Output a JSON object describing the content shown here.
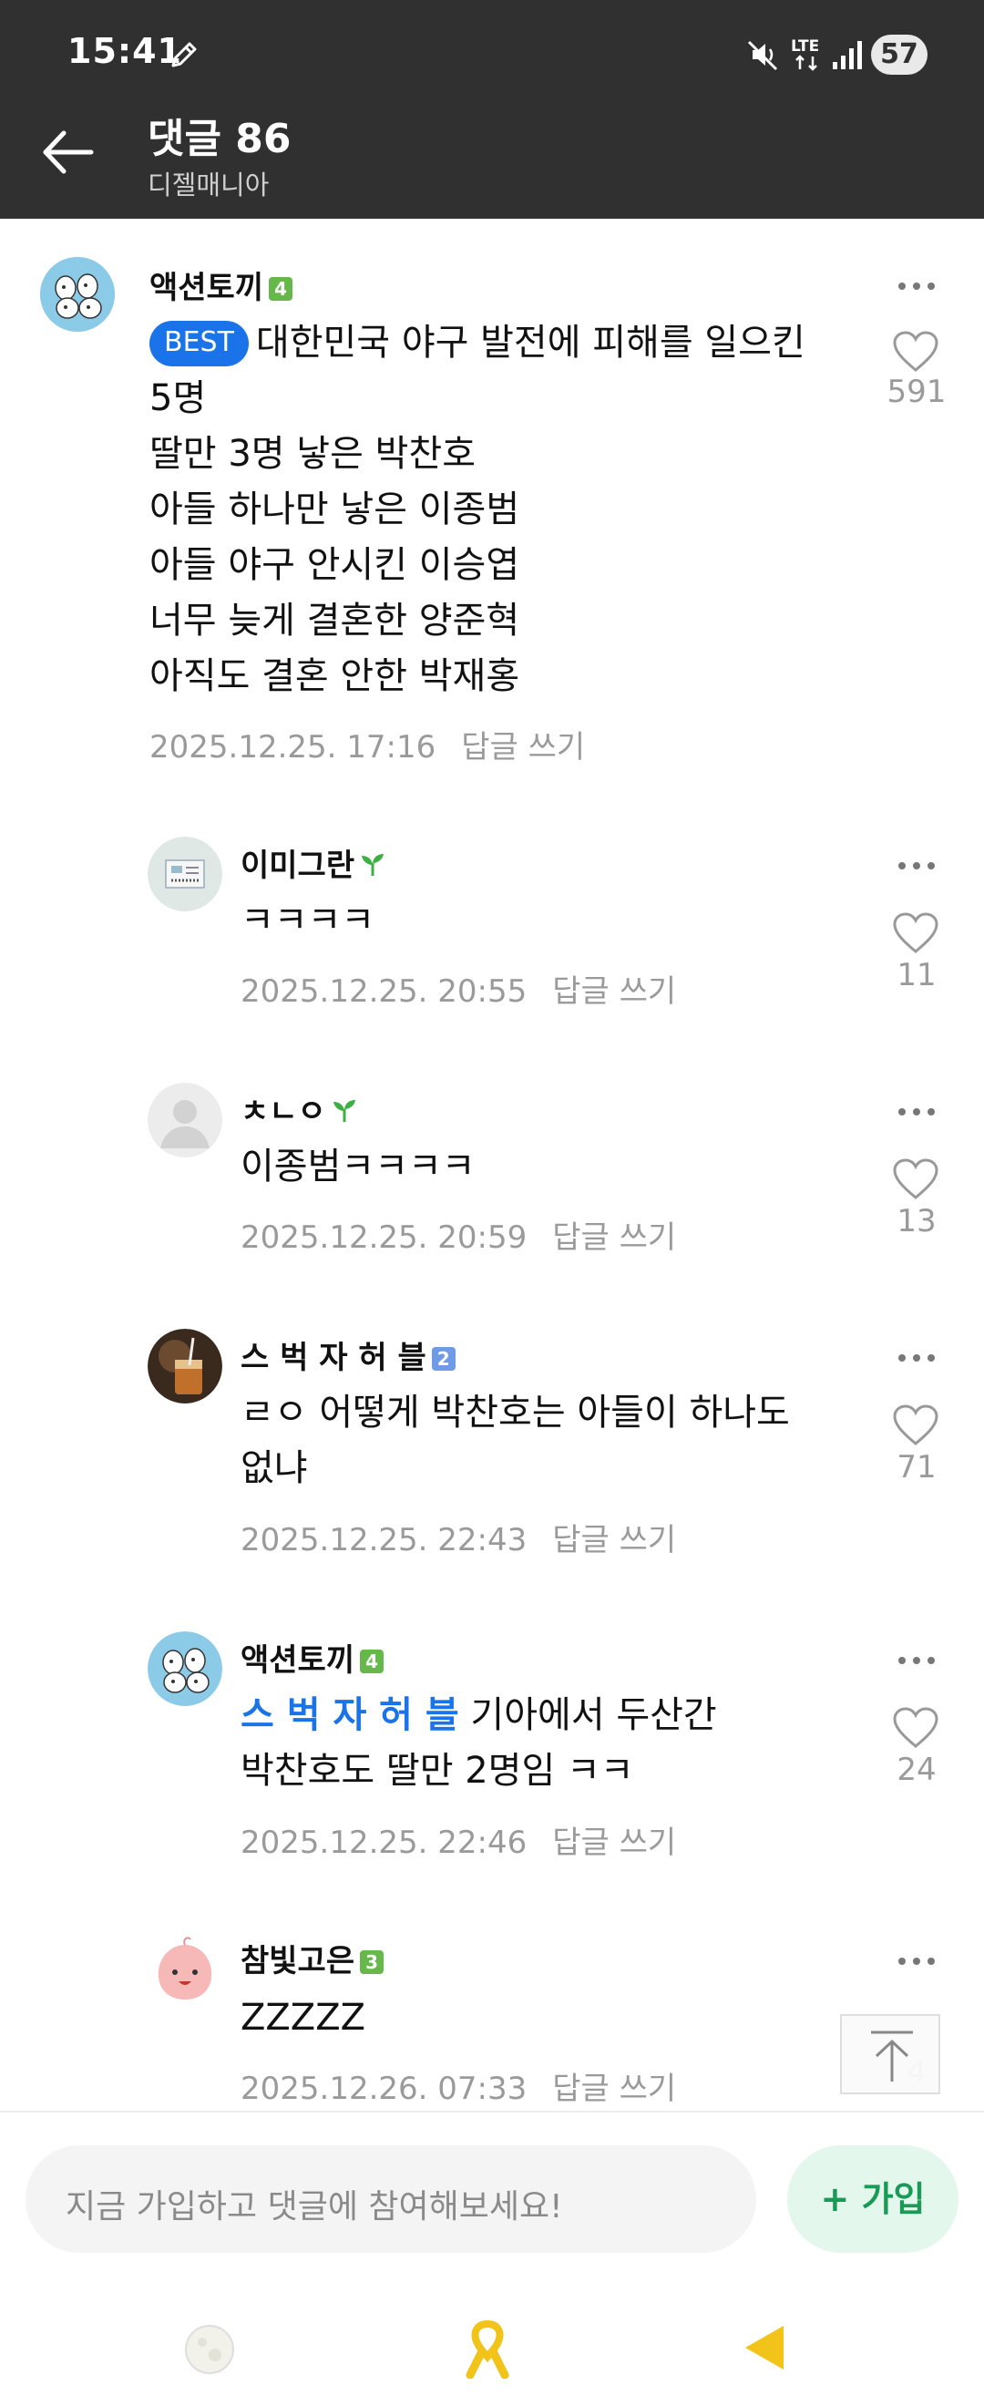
{
  "status_bar": {
    "time": "15:41",
    "network": "LTE",
    "battery": "57",
    "icons": [
      "pen-icon",
      "mute-icon",
      "lte-icon",
      "signal-icon",
      "battery-icon"
    ]
  },
  "header": {
    "title": "댓글 86",
    "subtitle": "디젤매니아"
  },
  "labels": {
    "reply": "답글 쓰기",
    "best": "BEST"
  },
  "comments": [
    {
      "nickname": "액션토끼",
      "level": "4",
      "best": true,
      "lines": [
        "대한민국 야구 발전에 피해를 일으킨",
        "5명",
        "딸만 3명 낳은 박찬호",
        "아들 하나만 낳은 이종범",
        "아들 야구 안시킨 이승엽",
        "너무 늦게 결혼한 양준혁",
        "아직도 결혼 안한 박재홍"
      ],
      "datetime": "2025.12.25. 17:16",
      "likes": "591"
    },
    {
      "nickname": "이미그란",
      "level_icon": "sprout-icon",
      "lines": [
        "ㅋㅋㅋㅋ"
      ],
      "datetime": "2025.12.25. 20:55",
      "likes": "11"
    },
    {
      "nickname": "ㅊㄴㅇ",
      "level_icon": "sprout-icon",
      "lines": [
        "이종범ㅋㅋㅋㅋ"
      ],
      "datetime": "2025.12.25. 20:59",
      "likes": "13"
    },
    {
      "nickname": "스 벅 자 허 블",
      "level": "2",
      "lines": [
        "ㄹㅇ 어떻게 박찬호는 아들이 하나도",
        "없냐"
      ],
      "datetime": "2025.12.25. 22:43",
      "likes": "71"
    },
    {
      "nickname": "액션토끼",
      "level": "4",
      "mention": "스 벅 자 허 블",
      "lines": [
        "기아에서 두산간",
        "박찬호도 딸만 2명임 ㅋㅋ"
      ],
      "datetime": "2025.12.25. 22:46",
      "likes": "24"
    },
    {
      "nickname": "참빛고은",
      "level": "3",
      "lines": [
        "ZZZZZ"
      ],
      "datetime": "2025.12.26. 07:33",
      "likes": "4"
    }
  ],
  "input": {
    "placeholder": "지금 가입하고 댓글에 참여해보세요!"
  },
  "join_button": {
    "label": "+ 가입"
  },
  "colors": {
    "header_bg": "#303030",
    "best_blue": "#1a73e8",
    "level_green": "#67b84a",
    "level_blue": "#6f9be6",
    "join_green": "#1a9a57"
  }
}
